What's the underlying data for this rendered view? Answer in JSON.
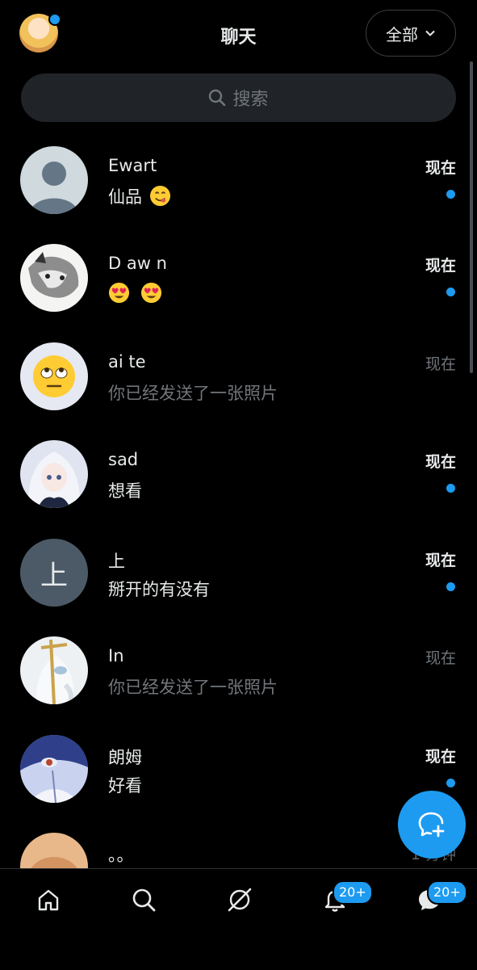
{
  "header": {
    "title": "聊天",
    "filter_label": "全部"
  },
  "search": {
    "placeholder": "搜索"
  },
  "conversations": [
    {
      "name": "Ewart",
      "message": "仙品",
      "time": "现在",
      "unread": true
    },
    {
      "name": "D aw n",
      "message": "",
      "time": "现在",
      "unread": true
    },
    {
      "name": "ai te",
      "message": "你已经发送了一张照片",
      "time": "现在",
      "unread": false
    },
    {
      "name": "sad",
      "message": "想看",
      "time": "现在",
      "unread": true
    },
    {
      "name": "上",
      "message": "掰开的有没有",
      "time": "现在",
      "unread": true,
      "avatar_letter": "上"
    },
    {
      "name": "In",
      "message": "你已经发送了一张照片",
      "time": "现在",
      "unread": false
    },
    {
      "name": "朗姆",
      "message": "好看",
      "time": "现在",
      "unread": true
    },
    {
      "name": "。。",
      "message": "",
      "time": "1 分钟",
      "unread": false
    }
  ],
  "tabbar": {
    "items": [
      "home-icon",
      "search-icon",
      "grok-icon",
      "notifications-icon",
      "messages-icon"
    ],
    "notifications_badge": "20+",
    "messages_badge": "20+"
  },
  "colors": {
    "accent": "#1d9bf0",
    "background": "#000000",
    "muted": "#71767b"
  }
}
